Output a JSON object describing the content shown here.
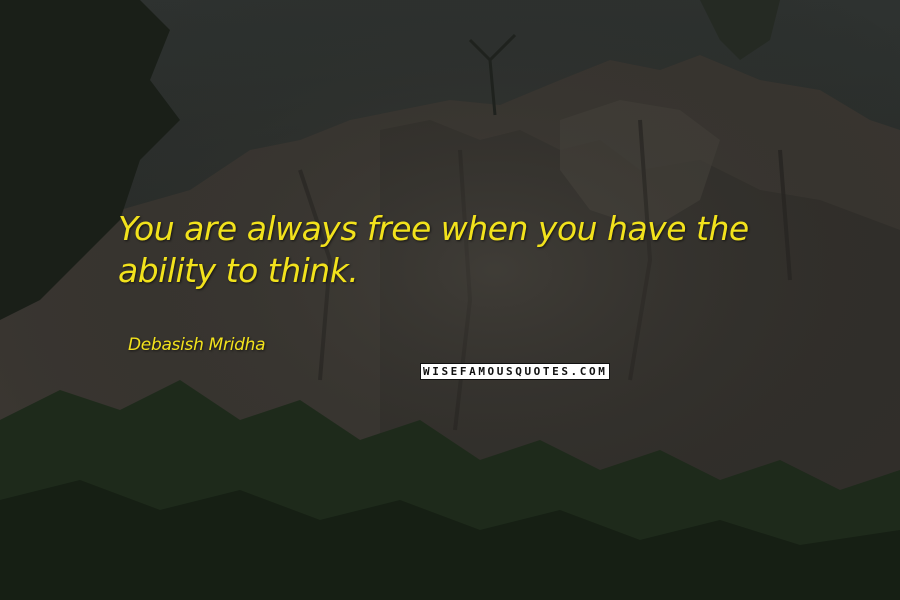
{
  "quote": {
    "text": "You are always free when you have the ability to think.",
    "color": "#f2e21c"
  },
  "author": {
    "name": "Debasish Mridha"
  },
  "watermark": {
    "text": "WISEFAMOUSQUOTES.COM"
  },
  "background": {
    "sky_color": "#2b2f2c",
    "rock_color": "#3c3833",
    "foliage_color": "#1f2a1c"
  }
}
